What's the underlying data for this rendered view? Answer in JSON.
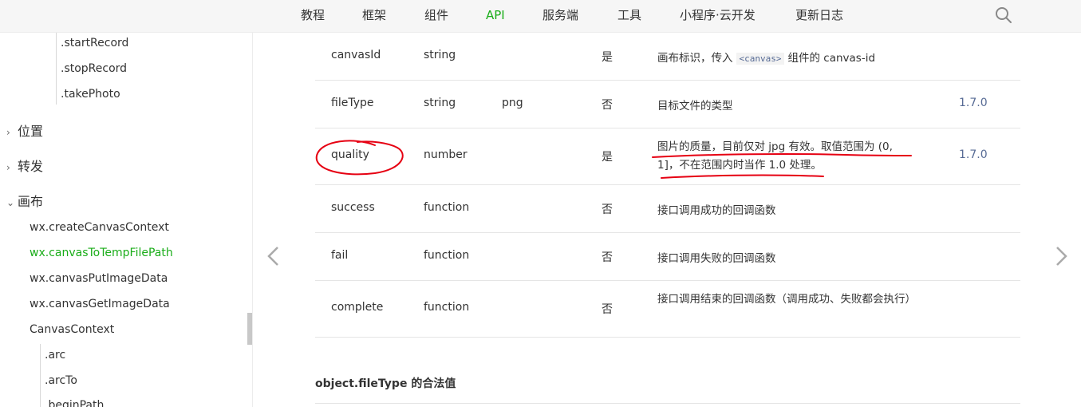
{
  "nav": {
    "items": [
      "教程",
      "框架",
      "组件",
      "API",
      "服务端",
      "工具",
      "小程序·云开发",
      "更新日志"
    ],
    "active_index": 3,
    "search_icon": "search-icon"
  },
  "sidebar": {
    "camera_items": [
      ".startRecord",
      ".stopRecord",
      ".takePhoto"
    ],
    "groups": [
      "位置",
      "转发",
      "画布"
    ],
    "canvas_items": [
      "wx.createCanvasContext",
      "wx.canvasToTempFilePath",
      "wx.canvasPutImageData",
      "wx.canvasGetImageData",
      "CanvasContext"
    ],
    "active_item": "wx.canvasToTempFilePath",
    "context_items": [
      ".arc",
      ".arcTo",
      ".beginPath"
    ]
  },
  "table": {
    "rows": [
      {
        "name": "canvasId",
        "type": "string",
        "default": "",
        "required": "是",
        "desc_pre": "画布标识，传入",
        "desc_code": "<canvas>",
        "desc_post": "组件的 canvas-id",
        "version": ""
      },
      {
        "name": "fileType",
        "type": "string",
        "default": "png",
        "required": "否",
        "desc": "目标文件的类型",
        "version": "1.7.0"
      },
      {
        "name": "quality",
        "type": "number",
        "default": "",
        "required": "是",
        "desc": "图片的质量，目前仅对 jpg 有效。取值范围为 (0, 1]，不在范围内时当作 1.0 处理。",
        "version": "1.7.0"
      },
      {
        "name": "success",
        "type": "function",
        "default": "",
        "required": "否",
        "desc": "接口调用成功的回调函数",
        "version": ""
      },
      {
        "name": "fail",
        "type": "function",
        "default": "",
        "required": "否",
        "desc": "接口调用失败的回调函数",
        "version": ""
      },
      {
        "name": "complete",
        "type": "function",
        "default": "",
        "required": "否",
        "desc": "接口调用结束的回调函数（调用成功、失败都会执行）",
        "version": ""
      }
    ]
  },
  "section": {
    "title": "object.fileType 的合法值"
  },
  "colors": {
    "accent": "#1aad19",
    "link": "#576b95",
    "annotation": "#e60012"
  }
}
